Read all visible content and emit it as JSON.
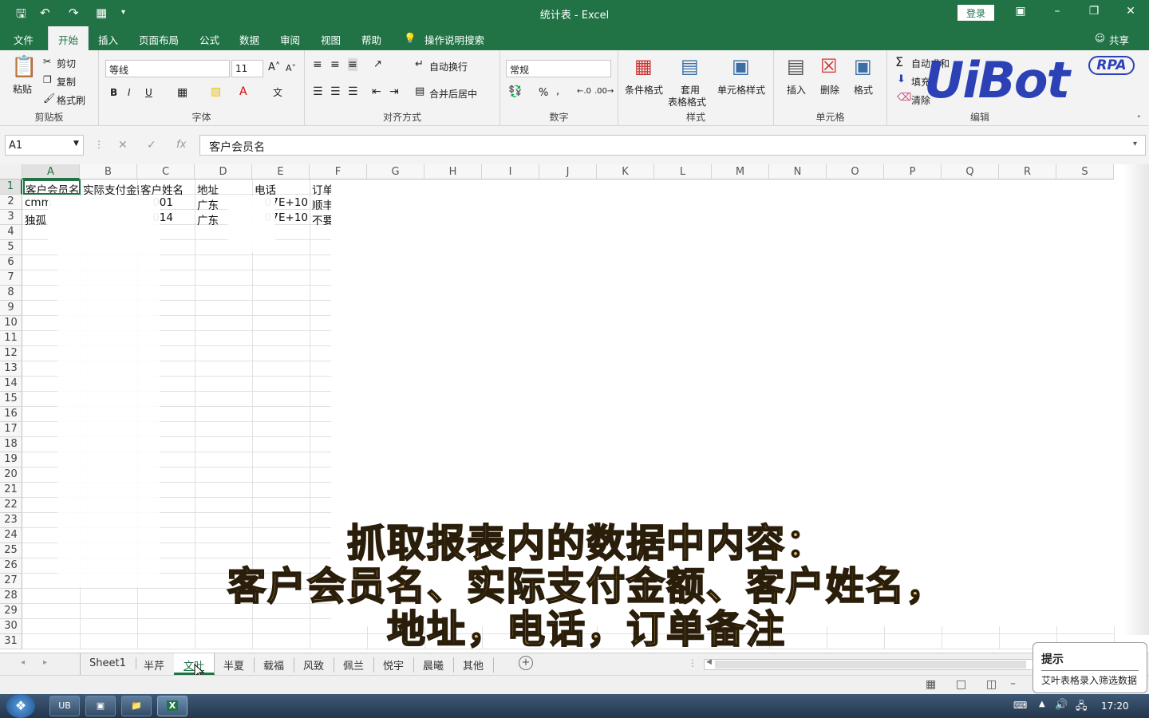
{
  "window": {
    "title": "统计表 - Excel",
    "login_label": "登录"
  },
  "ribbon_tabs": [
    "文件",
    "开始",
    "插入",
    "页面布局",
    "公式",
    "数据",
    "审阅",
    "视图",
    "帮助",
    "操作说明搜索"
  ],
  "share_label": "共享",
  "clipboard": {
    "paste": "粘贴",
    "cut": "剪切",
    "copy": "复制",
    "format_painter": "格式刷",
    "group": "剪贴板"
  },
  "font": {
    "name": "等线",
    "size": "11",
    "group": "字体",
    "bold": "B",
    "italic": "I",
    "underline": "U"
  },
  "alignment": {
    "wrap": "自动换行",
    "merge": "合并后居中",
    "group": "对齐方式"
  },
  "number": {
    "format": "常规",
    "percent": "%",
    "comma": ",",
    "group": "数字"
  },
  "styles": {
    "conditional": "条件格式",
    "table_l1": "套用",
    "table_l2": "表格格式",
    "cell_styles": "单元格样式",
    "group": "样式"
  },
  "cells": {
    "insert": "插入",
    "delete": "删除",
    "format": "格式",
    "group": "单元格"
  },
  "editing": {
    "autosum": "自动求和",
    "fill": "填充",
    "clear": "清除",
    "group": "编辑"
  },
  "formula_bar": {
    "name_box": "A1",
    "content": "客户会员名"
  },
  "columns": [
    "A",
    "B",
    "C",
    "D",
    "E",
    "F",
    "G",
    "H",
    "I",
    "J",
    "K",
    "L",
    "M",
    "N",
    "O",
    "P",
    "Q",
    "R",
    "S"
  ],
  "rows": [
    "1",
    "2",
    "3",
    "4",
    "5",
    "6",
    "7",
    "8",
    "9",
    "10",
    "11",
    "12",
    "13",
    "14",
    "15",
    "16",
    "17",
    "18",
    "19",
    "20",
    "21",
    "22",
    "23",
    "24",
    "25",
    "26",
    "27",
    "28",
    "29",
    "30",
    "31"
  ],
  "cells_data": {
    "r1": [
      "客户会员名",
      "实际支付金额",
      "客户姓名",
      "地址",
      "电话",
      "订单"
    ],
    "r2": [
      "cmm",
      "",
      "001",
      "广东",
      "07E+10",
      "顺丰"
    ],
    "r3": [
      "独孤",
      "",
      "014",
      "广东",
      "07E+10",
      "不要"
    ]
  },
  "sheet_tabs": [
    "Sheet1",
    "半芹",
    "文叶",
    "半夏",
    "载福",
    "风致",
    "佩兰",
    "悦宇",
    "晨曦",
    "其他"
  ],
  "active_sheet": "文叶",
  "overlay_lines": [
    "抓取报表内的数据中内容：",
    "客户会员名、实际支付金额、客户姓名，",
    "地址，电话，订单备注"
  ],
  "logo": {
    "brand": "UiBot",
    "badge": "RPA"
  },
  "tooltip": {
    "title": "提示",
    "message": "艾叶表格录入筛选数据"
  },
  "taskbar": {
    "time": "17:20",
    "ub_label": "UB"
  },
  "colors": {
    "excel_green": "#217346",
    "overlay_text": "#e2bb62",
    "logo_blue": "#2b41b5"
  }
}
